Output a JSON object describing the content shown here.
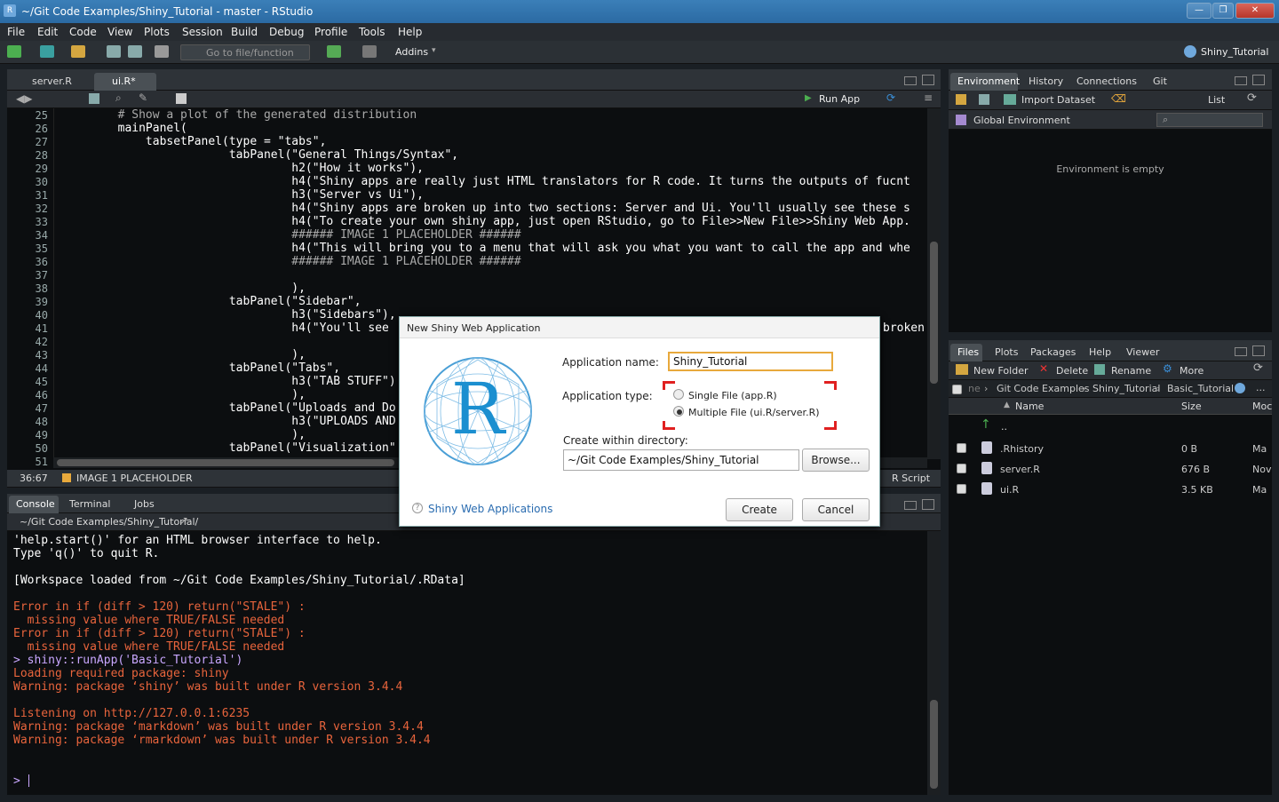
{
  "window": {
    "title": "~/Git Code Examples/Shiny_Tutorial - master - RStudio",
    "icon": "rstudio-icon"
  },
  "menu": [
    "File",
    "Edit",
    "Code",
    "View",
    "Plots",
    "Session",
    "Build",
    "Debug",
    "Profile",
    "Tools",
    "Help"
  ],
  "toolbar": {
    "goto_placeholder": "Go to file/function",
    "addins": "Addins",
    "project": "Shiny_Tutorial"
  },
  "editor": {
    "tabs": [
      "server.R",
      "ui.R*"
    ],
    "run_app": "Run App",
    "lines": [
      {
        "n": "25",
        "t": "        # Show a plot of the generated distribution",
        "c": "#aaa"
      },
      {
        "n": "26",
        "t": "        mainPanel(",
        "c": "#fff"
      },
      {
        "n": "27",
        "t": "            tabsetPanel(type = \"tabs\",",
        "c": "#fff"
      },
      {
        "n": "28",
        "t": "                        tabPanel(\"General Things/Syntax\",",
        "c": "#fff"
      },
      {
        "n": "29",
        "t": "                                 h2(\"How it works\"),",
        "c": "#fff"
      },
      {
        "n": "30",
        "t": "                                 h4(\"Shiny apps are really just HTML translators for R code. It turns the outputs of fucnt",
        "c": "#fff"
      },
      {
        "n": "31",
        "t": "                                 h3(\"Server vs Ui\"),",
        "c": "#fff"
      },
      {
        "n": "32",
        "t": "                                 h4(\"Shiny apps are broken up into two sections: Server and Ui. You'll usually see these s",
        "c": "#fff"
      },
      {
        "n": "33",
        "t": "                                 h4(\"To create your own shiny app, just open RStudio, go to File>>New File>>Shiny Web App.",
        "c": "#fff"
      },
      {
        "n": "34",
        "t": "                                 ###### IMAGE 1 PLACEHOLDER ######",
        "c": "#aaa"
      },
      {
        "n": "35",
        "t": "                                 h4(\"This will bring you to a menu that will ask you what you want to call the app and whe",
        "c": "#fff"
      },
      {
        "n": "36",
        "t": "                                 ###### IMAGE 1 PLACEHOLDER ######",
        "c": "#aaa"
      },
      {
        "n": "37",
        "t": "",
        "c": "#fff"
      },
      {
        "n": "38",
        "t": "                                 ),",
        "c": "#fff"
      },
      {
        "n": "39",
        "t": "                        tabPanel(\"Sidebar\",",
        "c": "#fff"
      },
      {
        "n": "40",
        "t": "                                 h3(\"Sidebars\"),",
        "c": "#fff"
      },
      {
        "n": "41",
        "t": "                                 h4(\"You'll see",
        "c": "#fff"
      },
      {
        "n": "42",
        "t": "",
        "c": "#fff"
      },
      {
        "n": "43",
        "t": "                                 ),",
        "c": "#fff"
      },
      {
        "n": "44",
        "t": "                        tabPanel(\"Tabs\",",
        "c": "#fff"
      },
      {
        "n": "45",
        "t": "                                 h3(\"TAB STUFF\")",
        "c": "#fff"
      },
      {
        "n": "46",
        "t": "                                 ),",
        "c": "#fff"
      },
      {
        "n": "47",
        "t": "                        tabPanel(\"Uploads and Do",
        "c": "#fff"
      },
      {
        "n": "48",
        "t": "                                 h3(\"UPLOADS AND",
        "c": "#fff"
      },
      {
        "n": "49",
        "t": "                                 ),",
        "c": "#fff"
      },
      {
        "n": "50",
        "t": "                        tabPanel(\"Visualization\"",
        "c": "#fff"
      },
      {
        "n": "51",
        "t": "",
        "c": "#fff"
      }
    ],
    "line41_tail": "broken",
    "status_pos": "36:67",
    "status_section": "IMAGE 1 PLACEHOLDER",
    "status_type": "R Script"
  },
  "console": {
    "tabs": [
      "Console",
      "Terminal",
      "Jobs"
    ],
    "path": "~/Git Code Examples/Shiny_Tutorial/",
    "lines": [
      {
        "t": "'help.start()' for an HTML browser interface to help.",
        "c": "#fff"
      },
      {
        "t": "Type 'q()' to quit R.",
        "c": "#fff"
      },
      {
        "t": "",
        "c": "#fff"
      },
      {
        "t": "[Workspace loaded from ~/Git Code Examples/Shiny_Tutorial/.RData]",
        "c": "#fff"
      },
      {
        "t": "",
        "c": "#fff"
      },
      {
        "t": "Error in if (diff > 120) return(\"STALE\") :",
        "c": "#e8643c"
      },
      {
        "t": "  missing value where TRUE/FALSE needed",
        "c": "#e8643c"
      },
      {
        "t": "Error in if (diff > 120) return(\"STALE\") :",
        "c": "#e8643c"
      },
      {
        "t": "  missing value where TRUE/FALSE needed",
        "c": "#e8643c"
      },
      {
        "t": "> shiny::runApp('Basic_Tutorial')",
        "c": "#c9a7ff"
      },
      {
        "t": "Loading required package: shiny",
        "c": "#e8643c"
      },
      {
        "t": "Warning: package ‘shiny’ was built under R version 3.4.4",
        "c": "#e8643c"
      },
      {
        "t": "",
        "c": "#fff"
      },
      {
        "t": "Listening on http://127.0.0.1:6235",
        "c": "#e8643c"
      },
      {
        "t": "Warning: package ‘markdown’ was built under R version 3.4.4",
        "c": "#e8643c"
      },
      {
        "t": "Warning: package ‘rmarkdown’ was built under R version 3.4.4",
        "c": "#e8643c"
      }
    ],
    "prompt": ">"
  },
  "env": {
    "tabs": [
      "Environment",
      "History",
      "Connections",
      "Git"
    ],
    "import": "Import Dataset",
    "list": "List",
    "scope": "Global Environment",
    "empty": "Environment is empty"
  },
  "files": {
    "tabs": [
      "Files",
      "Plots",
      "Packages",
      "Help",
      "Viewer"
    ],
    "new_folder": "New Folder",
    "delete": "Delete",
    "rename": "Rename",
    "more": "More",
    "breadcrumb": [
      "ne",
      "Git Code Examples",
      "Shiny_Tutorial",
      "Basic_Tutorial"
    ],
    "headers": {
      "name": "Name",
      "size": "Size",
      "mod": "Moc"
    },
    "up": "..",
    "rows": [
      {
        "name": ".Rhistory",
        "size": "0 B",
        "mod": "Ma"
      },
      {
        "name": "server.R",
        "size": "676 B",
        "mod": "Nov"
      },
      {
        "name": "ui.R",
        "size": "3.5 KB",
        "mod": "Ma"
      }
    ]
  },
  "dialog": {
    "title": "New Shiny Web Application",
    "name_label": "Application name:",
    "name_value": "Shiny_Tutorial",
    "type_label": "Application type:",
    "opt_single": "Single File (app.R)",
    "opt_multi": "Multiple File (ui.R/server.R)",
    "dir_label": "Create within directory:",
    "dir_value": "~/Git Code Examples/Shiny_Tutorial",
    "browse": "Browse...",
    "help_link": "Shiny Web Applications",
    "create": "Create",
    "cancel": "Cancel",
    "logo_letter": "R"
  }
}
